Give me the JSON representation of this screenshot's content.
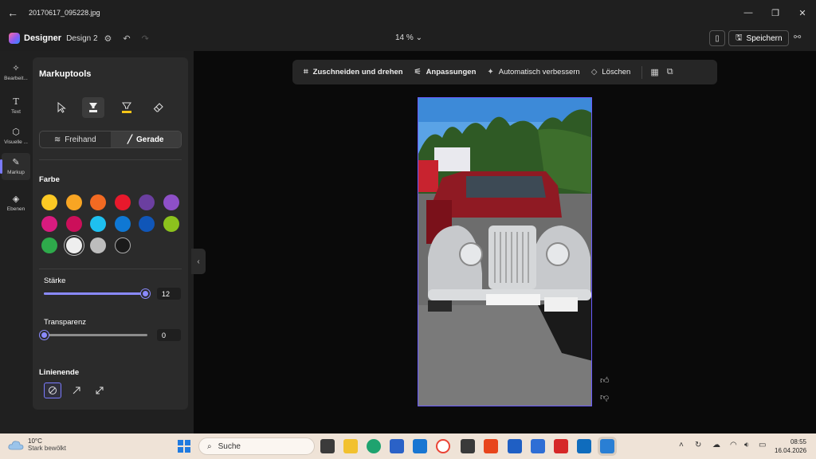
{
  "window": {
    "filename": "20170617_095228.jpg"
  },
  "header": {
    "app_name": "Designer",
    "doc_name": "Design 2",
    "zoom": "14 %",
    "save_label": "Speichern"
  },
  "rail": {
    "items": [
      {
        "label": "Bearbeit..."
      },
      {
        "label": "Text"
      },
      {
        "label": "Visuelle ..."
      },
      {
        "label": "Markup"
      },
      {
        "label": "Ebenen"
      }
    ]
  },
  "panel": {
    "title": "Markuptools",
    "mode_freehand": "Freihand",
    "mode_line": "Gerade",
    "color_label": "Farbe",
    "colors": [
      "#fcc924",
      "#f8a523",
      "#f26a22",
      "#e8192c",
      "#6b3fa0",
      "#8e50c8",
      "#d81b7f",
      "#cc0f5a",
      "#1ec0f0",
      "#0f78d4",
      "#1056b8",
      "#8cc21d",
      "#2eaa4b",
      "#eeeeee",
      "#bdbdbd",
      "#1a1a1a"
    ],
    "strength_label": "Stärke",
    "strength_value": "12",
    "strength_fraction": 0.98,
    "transparency_label": "Transparenz",
    "transparency_value": "0",
    "transparency_fraction": 0.0,
    "line_end_label": "Linienende",
    "accent": "#8a8aff"
  },
  "toolbar": {
    "crop": "Zuschneiden und drehen",
    "adjust": "Anpassungen",
    "auto": "Automatisch verbessern",
    "delete": "Löschen"
  },
  "taskbar": {
    "temp": "10°C",
    "weather": "Stark bewölkt",
    "search": "Suche",
    "time": "08:55",
    "date": "16.04.2026"
  }
}
